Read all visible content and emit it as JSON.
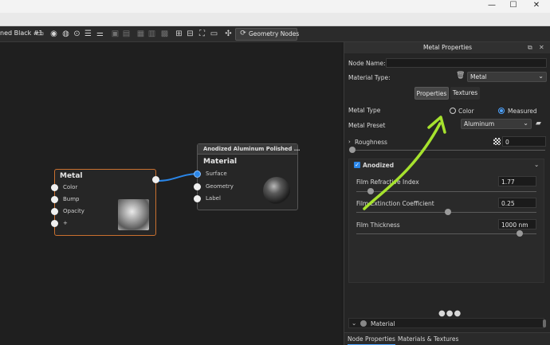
{
  "window": {
    "minimize_icon": "minimize-icon",
    "maximize_icon": "maximize-icon",
    "close_icon": "close-icon"
  },
  "toolbar": {
    "title": "ned Black #1",
    "geometry_nodes_label": "Geometry Nodes"
  },
  "canvas": {
    "metal_node": {
      "title": "Metal",
      "ports": [
        "Color",
        "Bump",
        "Opacity",
        "+"
      ]
    },
    "material_node": {
      "header": "Anodized Aluminum Polished ...",
      "title": "Material",
      "ports": [
        "Surface",
        "Geometry",
        "Label"
      ]
    }
  },
  "panel": {
    "title": "Metal Properties",
    "node_name_label": "Node Name:",
    "node_name_value": "",
    "material_type_label": "Material Type:",
    "material_type_value": "Metal",
    "tabs": [
      "Properties",
      "Textures"
    ],
    "metal_type_label": "Metal Type",
    "metal_type_options": [
      "Color",
      "Measured"
    ],
    "metal_type_selected": "Measured",
    "metal_preset_label": "Metal Preset",
    "metal_preset_value": "Aluminum",
    "roughness_label": "Roughness",
    "roughness_value": "0",
    "anodized_label": "Anodized",
    "film_refractive_label": "Film Refractive Index",
    "film_refractive_value": "1.77",
    "film_extinction_label": "Film Extinction Coefficient",
    "film_extinction_value": "0.25",
    "film_thickness_label": "Film Thickness",
    "film_thickness_value": "1000 nm",
    "material_section_label": "Material",
    "bottom_tabs": [
      "Node Properties",
      "Materials & Textures"
    ]
  },
  "colors": {
    "metal_node_border": "#c9702f",
    "wire": "#2a86e8",
    "annotation_arrow": "#a6e22e",
    "accent": "#4da3ff"
  }
}
